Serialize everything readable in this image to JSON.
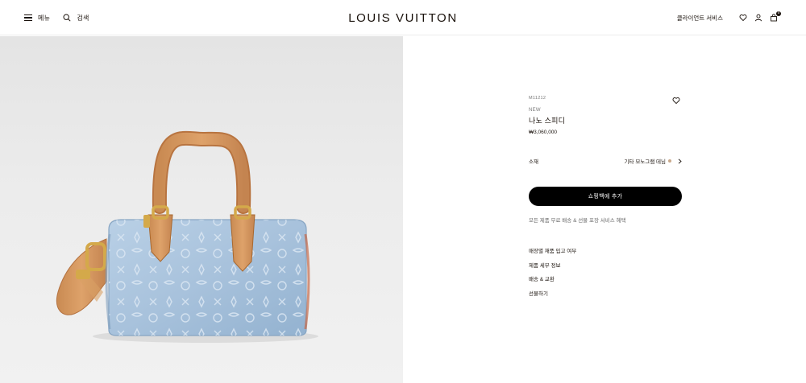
{
  "header": {
    "menu_label": "메뉴",
    "search_label": "검색",
    "logo": "LOUIS VUITTON",
    "client_service": "클라이언트 서비스",
    "cart_count": "0",
    "icons": [
      "hamburger-icon",
      "search-icon",
      "heart-icon",
      "user-icon",
      "bag-icon"
    ]
  },
  "product": {
    "sku": "M11212",
    "badge": "NEW",
    "name": "나노 스피디",
    "price": "₩3,060,000",
    "material_label": "소재",
    "material_value": "기타 모노그램 데님",
    "add_to_cart": "쇼핑백에 추가",
    "shipping_note": "모든 제품 무료 배송 & 선물 포장 서비스 혜택",
    "links": [
      "매장별 재품 입고 여부",
      "제품 세부 정보",
      "배송 & 교환",
      "선물하기"
    ]
  },
  "colors": {
    "text": "#19110b",
    "button_bg": "#000000",
    "button_text": "#ffffff",
    "denim": "#a9c3dc",
    "leather": "#d89a60"
  }
}
